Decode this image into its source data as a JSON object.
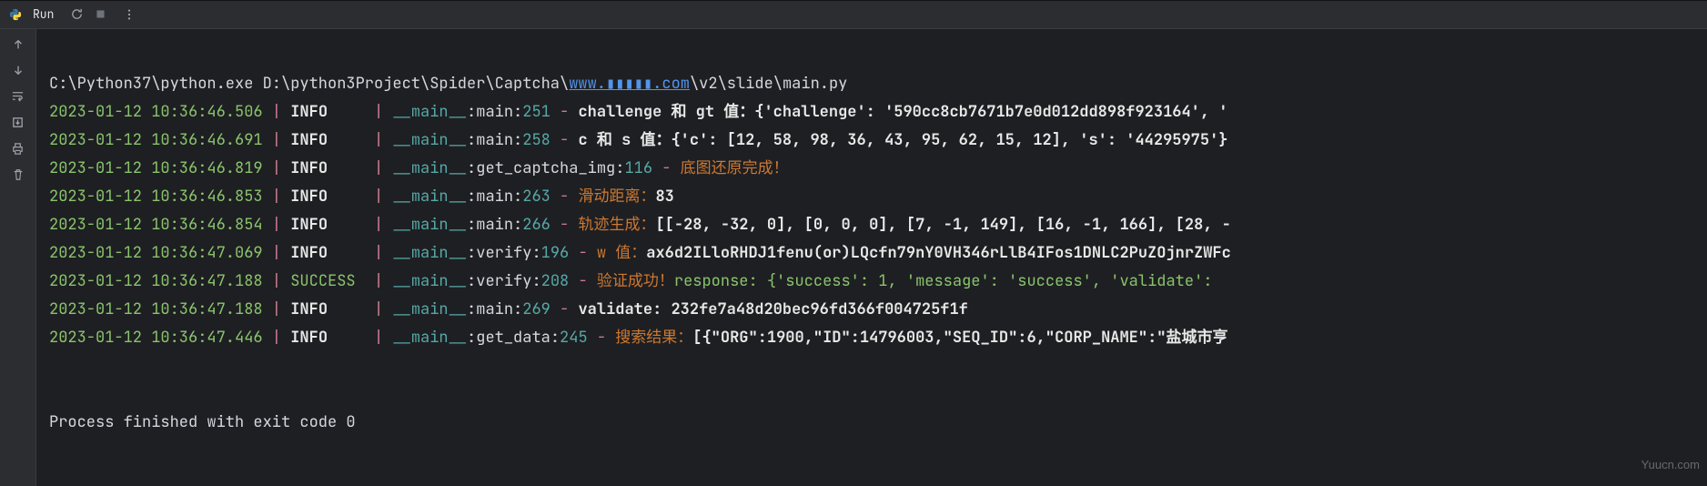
{
  "titlebar": {
    "tool_label": "Run",
    "icons": {
      "rerun": "rerun-icon",
      "stop": "stop-icon",
      "more": "more-icon"
    }
  },
  "gutter": {
    "icons": [
      "arrow-up-icon",
      "arrow-down-icon",
      "soft-wrap-icon",
      "scroll-end-icon",
      "print-icon",
      "trash-icon"
    ]
  },
  "cmd": {
    "prefix": "C:\\Python37\\python.exe D:\\python3Project\\Spider\\Captcha\\",
    "link": "www.▮▮▮▮▮.com",
    "suffix": "\\v2\\slide\\main.py"
  },
  "lines": [
    {
      "ts": "2023-01-12 10:36:46.506",
      "lvl": "INFO",
      "loc": "__main__",
      "fn": "main",
      "ln": "251",
      "dash": " - ",
      "msg": "challenge 和 gt 值：{'challenge': '590cc8cb7671b7e0d012dd898f923164', '"
    },
    {
      "ts": "2023-01-12 10:36:46.691",
      "lvl": "INFO",
      "loc": "__main__",
      "fn": "main",
      "ln": "258",
      "dash": " - ",
      "msg": "c 和 s 值：{'c': [12, 58, 98, 36, 43, 95, 62, 15, 12], 's': '44295975'}"
    },
    {
      "ts": "2023-01-12 10:36:46.819",
      "lvl": "INFO",
      "loc": "__main__",
      "fn": "get_captcha_img",
      "ln": "116",
      "dash": " - ",
      "cn": "底图还原完成！"
    },
    {
      "ts": "2023-01-12 10:36:46.853",
      "lvl": "INFO",
      "loc": "__main__",
      "fn": "main",
      "ln": "263",
      "dash": " - ",
      "cn": "滑动距离：",
      "msg": "83"
    },
    {
      "ts": "2023-01-12 10:36:46.854",
      "lvl": "INFO",
      "loc": "__main__",
      "fn": "main",
      "ln": "266",
      "dash": " - ",
      "cn": "轨迹生成：",
      "msg": "[[-28, -32, 0], [0, 0, 0], [7, -1, 149], [16, -1, 166], [28, -"
    },
    {
      "ts": "2023-01-12 10:36:47.069",
      "lvl": "INFO",
      "loc": "__main__",
      "fn": "verify",
      "ln": "196",
      "dash": " - ",
      "cn": "w 值：",
      "msg": "ax6d2ILloRHDJ1fenu(or)LQcfn79nY0VH346rLlB4IFos1DNLC2PuZOjnrZWFc"
    },
    {
      "ts": "2023-01-12 10:36:47.188",
      "lvl": "SUCCESS",
      "loc": "__main__",
      "fn": "verify",
      "ln": "208",
      "dash": " - ",
      "cn": "验证成功！",
      "greenmsg": "response: {'success': 1, 'message': 'success', 'validate': "
    },
    {
      "ts": "2023-01-12 10:36:47.188",
      "lvl": "INFO",
      "loc": "__main__",
      "fn": "main",
      "ln": "269",
      "dash": " - ",
      "msg": "validate: 232fe7a48d20bec96fd366f004725f1f"
    },
    {
      "ts": "2023-01-12 10:36:47.446",
      "lvl": "INFO",
      "loc": "__main__",
      "fn": "get_data",
      "ln": "245",
      "dash": " - ",
      "cn": "搜索结果：",
      "msg": "[{\"ORG\":1900,\"ID\":14796003,\"SEQ_ID\":6,\"CORP_NAME\":\"盐城市亨"
    }
  ],
  "exit": "Process finished with exit code 0",
  "watermark": "Yuucn.com"
}
